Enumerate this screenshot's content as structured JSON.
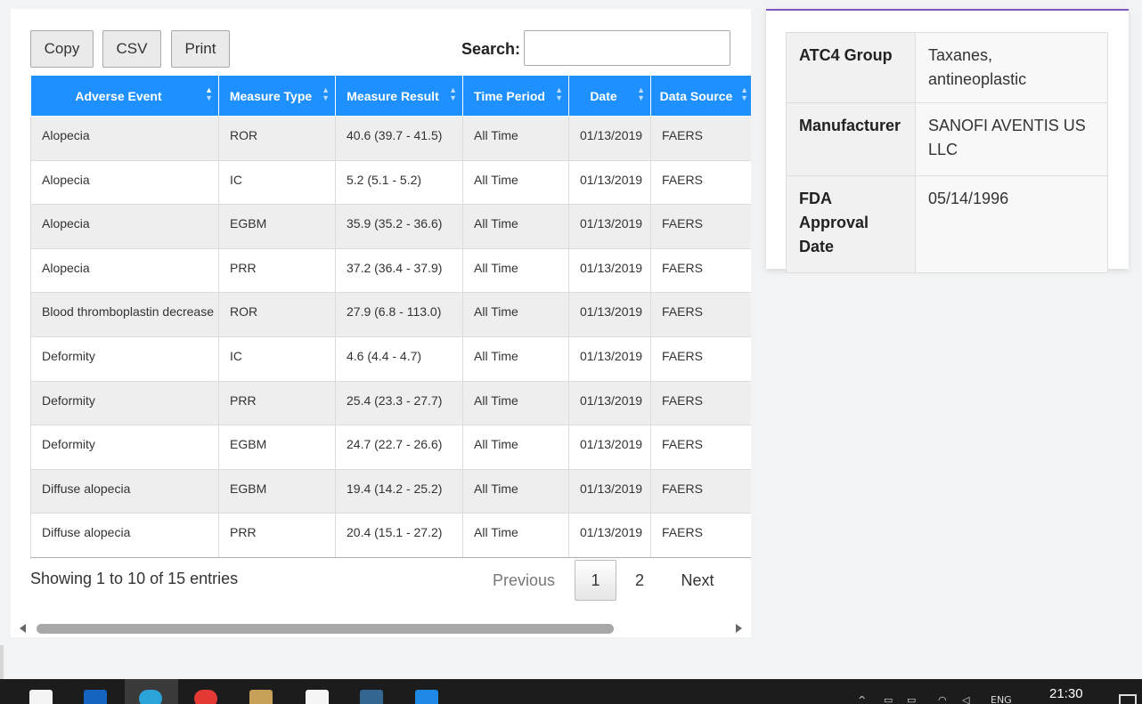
{
  "toolbar": {
    "copy_label": "Copy",
    "csv_label": "CSV",
    "print_label": "Print",
    "search_label": "Search:",
    "search_value": ""
  },
  "table": {
    "columns": [
      "Adverse Event",
      "Measure Type",
      "Measure Result",
      "Time Period",
      "Date",
      "Data Source"
    ],
    "rows": [
      [
        "Alopecia",
        "ROR",
        "40.6 (39.7 - 41.5)",
        "All Time",
        "01/13/2019",
        "FAERS"
      ],
      [
        "Alopecia",
        "IC",
        "5.2 (5.1 - 5.2)",
        "All Time",
        "01/13/2019",
        "FAERS"
      ],
      [
        "Alopecia",
        "EGBM",
        "35.9 (35.2 - 36.6)",
        "All Time",
        "01/13/2019",
        "FAERS"
      ],
      [
        "Alopecia",
        "PRR",
        "37.2 (36.4 - 37.9)",
        "All Time",
        "01/13/2019",
        "FAERS"
      ],
      [
        "Blood thromboplastin decrease",
        "ROR",
        "27.9 (6.8 - 113.0)",
        "All Time",
        "01/13/2019",
        "FAERS"
      ],
      [
        "Deformity",
        "IC",
        "4.6 (4.4 - 4.7)",
        "All Time",
        "01/13/2019",
        "FAERS"
      ],
      [
        "Deformity",
        "PRR",
        "25.4 (23.3 - 27.7)",
        "All Time",
        "01/13/2019",
        "FAERS"
      ],
      [
        "Deformity",
        "EGBM",
        "24.7 (22.7 - 26.6)",
        "All Time",
        "01/13/2019",
        "FAERS"
      ],
      [
        "Diffuse alopecia",
        "EGBM",
        "19.4 (14.2 - 25.2)",
        "All Time",
        "01/13/2019",
        "FAERS"
      ],
      [
        "Diffuse alopecia",
        "PRR",
        "20.4 (15.1 - 27.2)",
        "All Time",
        "01/13/2019",
        "FAERS"
      ]
    ]
  },
  "pagination": {
    "info": "Showing 1 to 10 of 15 entries",
    "previous": "Previous",
    "page1": "1",
    "page2": "2",
    "next": "Next"
  },
  "drug_info": [
    {
      "key": "ATC4 Group",
      "value": "Taxanes, antineoplastic"
    },
    {
      "key": "Manufacturer",
      "value": "SANOFI AVENTIS US LLC"
    },
    {
      "key": "FDA Approval Date",
      "value": "05/14/1996"
    }
  ],
  "taskbar": {
    "language": "ENG",
    "time": "21:30"
  },
  "colors": {
    "header_blue": "#1e90ff",
    "accent_purple": "#7e57c2",
    "taskbar": "#1c1c1c"
  }
}
